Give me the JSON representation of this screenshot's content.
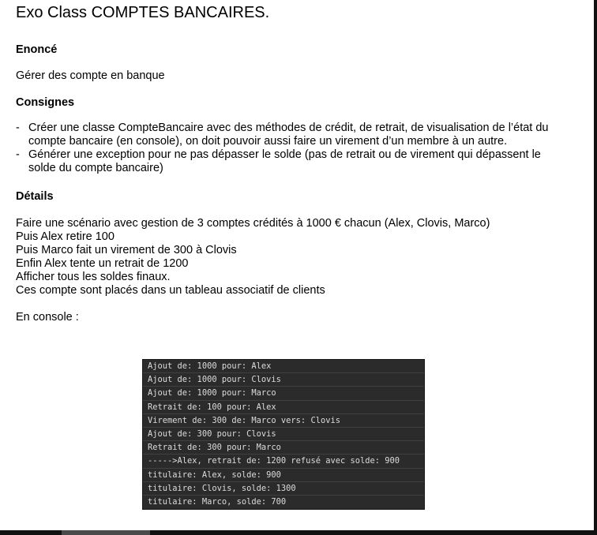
{
  "document": {
    "title": "Exo Class COMPTES BANCAIRES.",
    "enonce": {
      "heading": "Enoncé",
      "text": "Gérer des compte en banque"
    },
    "consignes": {
      "heading": "Consignes",
      "items": [
        "Créer une classe CompteBancaire avec des méthodes de crédit, de retrait, de visualisation de l’état du compte bancaire (en console), on doit pouvoir aussi faire un virement d’un membre à un autre.",
        "Générer une exception pour ne pas dépasser le solde (pas de retrait ou de virement qui dépassent le solde du compte bancaire)"
      ]
    },
    "details": {
      "heading": "Détails",
      "lines": [
        "Faire une scénario avec gestion de 3 comptes crédités à 1000 € chacun (Alex, Clovis, Marco)",
        "Puis Alex retire 100",
        "Puis Marco fait un virement de 300 à Clovis",
        "Enfin Alex tente un retrait de 1200",
        "Afficher tous les soldes finaux.",
        "Ces compte sont placés dans un tableau associatif de clients"
      ],
      "console_label": "En console :"
    },
    "console_output": [
      "Ajout de: 1000 pour: Alex",
      "Ajout de: 1000 pour: Clovis",
      "Ajout de: 1000 pour: Marco",
      "Retrait de: 100 pour: Alex",
      "Virement de: 300 de: Marco vers: Clovis",
      "Ajout de: 300 pour: Clovis",
      "Retrait de: 300 pour: Marco",
      "----->Alex, retrait de: 1200 refusé avec solde: 900",
      "titulaire: Alex, solde: 900",
      "titulaire: Clovis, solde: 1300",
      "titulaire: Marco, solde: 700"
    ]
  }
}
